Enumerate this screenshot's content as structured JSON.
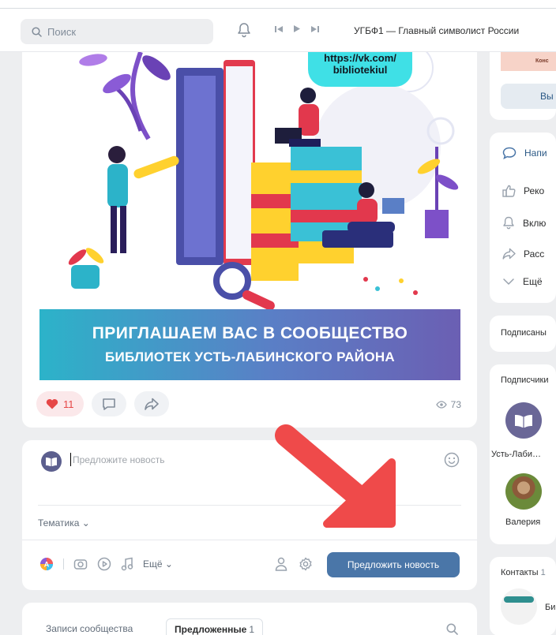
{
  "header": {
    "search_placeholder": "Поиск",
    "now_playing": "УГБФ1 — Главный символист России"
  },
  "post": {
    "banner_url": "https://vk.com/ bibliotekiul",
    "banner_line1": "ПРИГЛАШАЕМ ВАС В СООБЩЕСТВО",
    "banner_line2": "БИБЛИОТЕК УСТЬ-ЛАБИНСКОГО РАЙОНА",
    "likes": "11",
    "views": "73"
  },
  "suggest": {
    "placeholder": "Предложите новость",
    "topic_label": "Тематика",
    "more_label": "Ещё",
    "submit_label": "Предложить новость"
  },
  "feed_tabs": {
    "tab_all": "Записи сообщества",
    "tab_suggested": "Предложенные",
    "tab_suggested_count": "1"
  },
  "sidebar": {
    "top_image_text": "Конс",
    "top_button": "Вы",
    "menu": [
      "Напи",
      "Реко",
      "Вклю",
      "Расс",
      "Ещё"
    ],
    "subscribed": "Подписаны",
    "subscribers_title": "Подписчики",
    "subscriber1": "Усть-Лаби…",
    "subscriber2": "Валерия",
    "contacts_title": "Контакты",
    "contacts_count": "1",
    "contact_name": "Би"
  },
  "colors": {
    "accent": "#4a76a8",
    "like": "#e64646",
    "arrow": "#ef4a4a"
  }
}
